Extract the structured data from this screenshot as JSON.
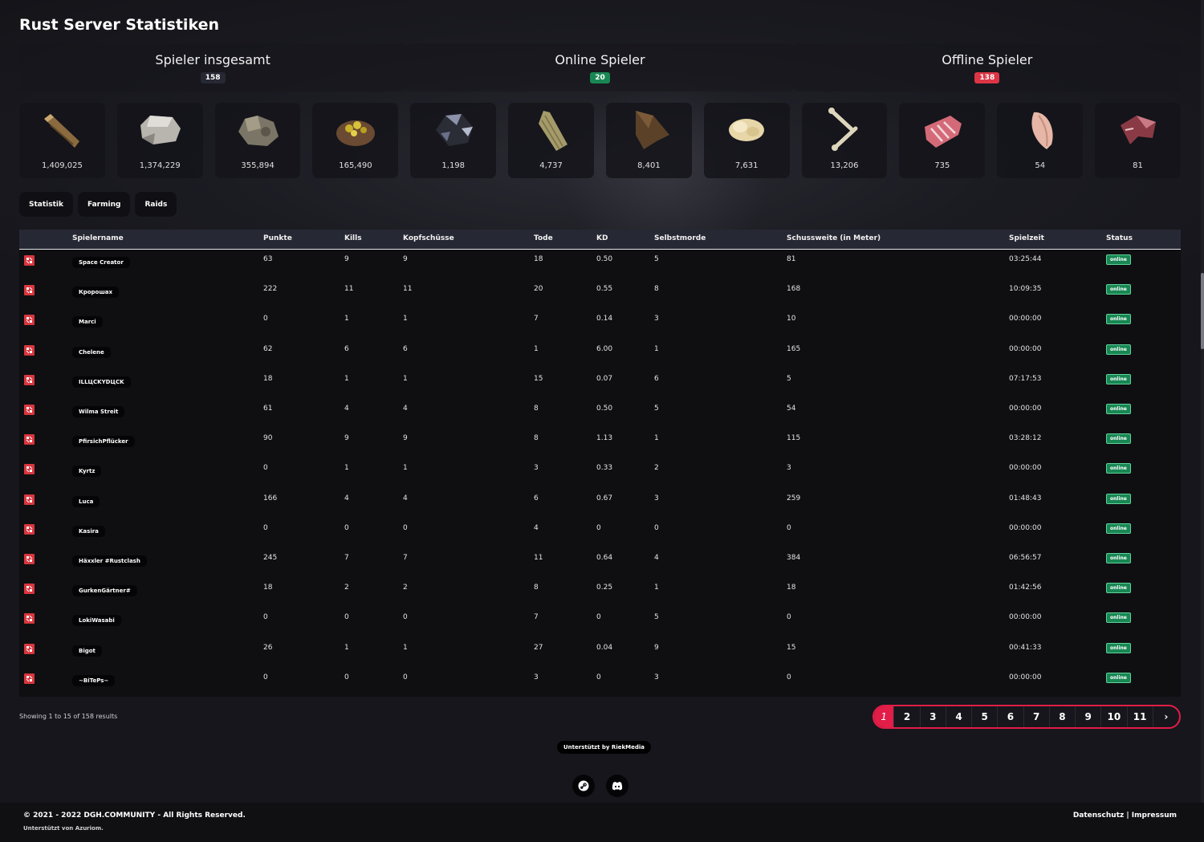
{
  "page_title": "Rust Server Statistiken",
  "summary": [
    {
      "title": "Spieler insgesamt",
      "count": "158",
      "badge_color": "#262833"
    },
    {
      "title": "Online Spieler",
      "count": "20",
      "badge_color": "#198754"
    },
    {
      "title": "Offline Spieler",
      "count": "138",
      "badge_color": "#dc3545"
    }
  ],
  "resources": [
    {
      "icon": "wood-icon",
      "value": "1,409,025"
    },
    {
      "icon": "stones-icon",
      "value": "1,374,229"
    },
    {
      "icon": "metal-ore-icon",
      "value": "355,894"
    },
    {
      "icon": "sulfur-ore-icon",
      "value": "165,490"
    },
    {
      "icon": "hq-metal-ore-icon",
      "value": "1,198"
    },
    {
      "icon": "cloth-icon",
      "value": "4,737"
    },
    {
      "icon": "leather-icon",
      "value": "8,401"
    },
    {
      "icon": "animal-fat-icon",
      "value": "7,631"
    },
    {
      "icon": "bone-fragments-icon",
      "value": "13,206"
    },
    {
      "icon": "raw-pork-icon",
      "value": "735"
    },
    {
      "icon": "raw-chicken-icon",
      "value": "54"
    },
    {
      "icon": "raw-meat-icon",
      "value": "81"
    }
  ],
  "tabs": [
    "Statistik",
    "Farming",
    "Raids"
  ],
  "table": {
    "headers": [
      "Spielername",
      "Punkte",
      "Kills",
      "Kopfschüsse",
      "Tode",
      "KD",
      "Selbstmorde",
      "Schussweite (in Meter)",
      "Spielzeit",
      "Status"
    ],
    "rows": [
      {
        "name": "Space Creator",
        "punkte": "63",
        "kills": "9",
        "kopf": "9",
        "tode": "18",
        "kd": "0.50",
        "selbst": "5",
        "weite": "81",
        "zeit": "03:25:44",
        "status": "online"
      },
      {
        "name": "Кророшах",
        "punkte": "222",
        "kills": "11",
        "kopf": "11",
        "tode": "20",
        "kd": "0.55",
        "selbst": "8",
        "weite": "168",
        "zeit": "10:09:35",
        "status": "online"
      },
      {
        "name": "Marci",
        "punkte": "0",
        "kills": "1",
        "kopf": "1",
        "tode": "7",
        "kd": "0.14",
        "selbst": "3",
        "weite": "10",
        "zeit": "00:00:00",
        "status": "online"
      },
      {
        "name": "Chelene",
        "punkte": "62",
        "kills": "6",
        "kopf": "6",
        "tode": "1",
        "kd": "6.00",
        "selbst": "1",
        "weite": "165",
        "zeit": "00:00:00",
        "status": "online"
      },
      {
        "name": "ILLЦCKYDЦCK",
        "punkte": "18",
        "kills": "1",
        "kopf": "1",
        "tode": "15",
        "kd": "0.07",
        "selbst": "6",
        "weite": "5",
        "zeit": "07:17:53",
        "status": "online"
      },
      {
        "name": "Wilma Streit",
        "punkte": "61",
        "kills": "4",
        "kopf": "4",
        "tode": "8",
        "kd": "0.50",
        "selbst": "5",
        "weite": "54",
        "zeit": "00:00:00",
        "status": "online"
      },
      {
        "name": "PfirsichPflücker",
        "punkte": "90",
        "kills": "9",
        "kopf": "9",
        "tode": "8",
        "kd": "1.13",
        "selbst": "1",
        "weite": "115",
        "zeit": "03:28:12",
        "status": "online"
      },
      {
        "name": "Kyrtz",
        "punkte": "0",
        "kills": "1",
        "kopf": "1",
        "tode": "3",
        "kd": "0.33",
        "selbst": "2",
        "weite": "3",
        "zeit": "00:00:00",
        "status": "online"
      },
      {
        "name": "Luca",
        "punkte": "166",
        "kills": "4",
        "kopf": "4",
        "tode": "6",
        "kd": "0.67",
        "selbst": "3",
        "weite": "259",
        "zeit": "01:48:43",
        "status": "online"
      },
      {
        "name": "Kasira",
        "punkte": "0",
        "kills": "0",
        "kopf": "0",
        "tode": "4",
        "kd": "0",
        "selbst": "0",
        "weite": "0",
        "zeit": "00:00:00",
        "status": "online"
      },
      {
        "name": "Häxxler #Rustclash",
        "punkte": "245",
        "kills": "7",
        "kopf": "7",
        "tode": "11",
        "kd": "0.64",
        "selbst": "4",
        "weite": "384",
        "zeit": "06:56:57",
        "status": "online"
      },
      {
        "name": "GurkenGärtner#",
        "punkte": "18",
        "kills": "2",
        "kopf": "2",
        "tode": "8",
        "kd": "0.25",
        "selbst": "1",
        "weite": "18",
        "zeit": "01:42:56",
        "status": "online"
      },
      {
        "name": "LokiWasabi",
        "punkte": "0",
        "kills": "0",
        "kopf": "0",
        "tode": "7",
        "kd": "0",
        "selbst": "5",
        "weite": "0",
        "zeit": "00:00:00",
        "status": "online"
      },
      {
        "name": "Bigot",
        "punkte": "26",
        "kills": "1",
        "kopf": "1",
        "tode": "27",
        "kd": "0.04",
        "selbst": "9",
        "weite": "15",
        "zeit": "00:41:33",
        "status": "online"
      },
      {
        "name": "~BiTePs~",
        "punkte": "0",
        "kills": "0",
        "kopf": "0",
        "tode": "3",
        "kd": "0",
        "selbst": "3",
        "weite": "0",
        "zeit": "00:00:00",
        "status": "online"
      }
    ]
  },
  "showing_text": "Showing 1 to 15 of 158 results",
  "pagination": {
    "pages": [
      "1",
      "2",
      "3",
      "4",
      "5",
      "6",
      "7",
      "8",
      "9",
      "10",
      "11"
    ],
    "active": "1",
    "next": "›"
  },
  "supported_by": "Unterstützt by RiekMedia",
  "social": [
    {
      "icon": "steam-icon"
    },
    {
      "icon": "discord-icon"
    }
  ],
  "footer": {
    "copyright": "© 2021 - 2022 DGH.COMMUNITY - All Rights Reserved.",
    "powered_by": "Unterstützt von Azuriom.",
    "links": "Datenschutz | Impressum"
  },
  "colors": {
    "accent": "#e11d48",
    "online": "#198754",
    "offline": "#dc3545"
  }
}
